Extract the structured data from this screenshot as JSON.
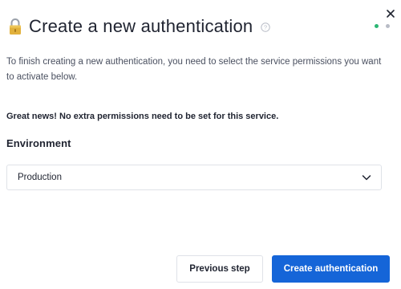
{
  "dialog": {
    "title": "Create a new authentication",
    "description": "To finish creating a new authentication, you need to select the service permissions you want to activate below.",
    "notice": "Great news! No extra permissions need to be set for this service.",
    "icons": {
      "title_icon": "lock-icon",
      "help_icon": "question-circle-icon",
      "close_icon": "close-icon",
      "select_icon": "chevron-down-icon"
    }
  },
  "steps": {
    "total": 2,
    "current": 1,
    "active_color": "#2bb673",
    "inactive_color": "#b8bcc6"
  },
  "environment": {
    "label": "Environment",
    "selected": "Production"
  },
  "buttons": {
    "previous": "Previous step",
    "create": "Create authentication"
  },
  "colors": {
    "primary": "#1565d8",
    "text": "#1f2330",
    "border": "#dfe2e8"
  }
}
